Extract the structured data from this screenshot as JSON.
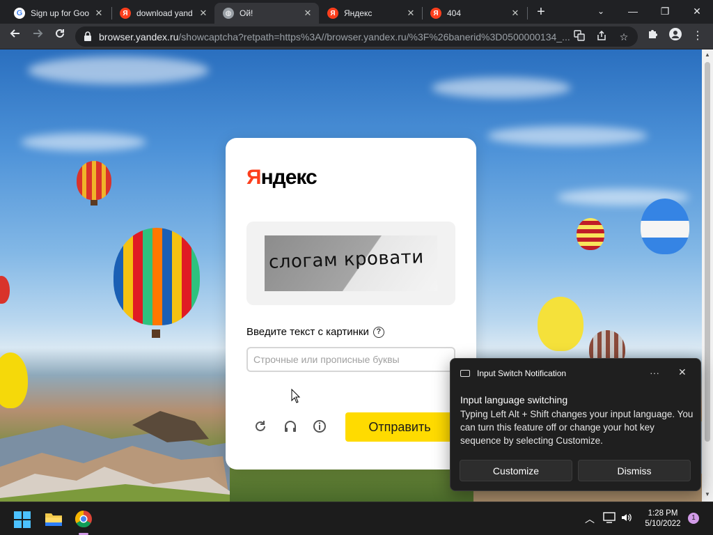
{
  "browser": {
    "tabs": [
      {
        "title": "Sign up for Goo",
        "favicon": "google-icon"
      },
      {
        "title": "download yand",
        "favicon": "yandex-icon"
      },
      {
        "title": "Ой!",
        "favicon": "globe-icon",
        "active": true
      },
      {
        "title": "Яндекс",
        "favicon": "yandex-icon"
      },
      {
        "title": "404",
        "favicon": "yandex-icon"
      }
    ],
    "url_host": "browser.yandex.ru",
    "url_path": "/showcaptcha?retpath=https%3A//browser.yandex.ru/%3F%26banerid%3D0500000134_..."
  },
  "captcha": {
    "logo": "Яндекс",
    "logo_first": "Я",
    "logo_rest": "ндекс",
    "image_text": "слогам кровати",
    "prompt": "Введите текст с картинки",
    "help_glyph": "?",
    "input_placeholder": "Строчные или прописные буквы",
    "input_value": "",
    "submit_label": "Отправить",
    "accent_color": "#ffdb00",
    "logo_color": "#fc3f1d"
  },
  "notification": {
    "app": "Input Switch Notification",
    "title": "Input language switching",
    "body": "Typing Left Alt + Shift changes your input language. You can turn this feature off or change your hot key sequence by selecting Customize.",
    "customize_label": "Customize",
    "dismiss_label": "Dismiss",
    "more_glyph": "···"
  },
  "taskbar": {
    "time": "1:28 PM",
    "date": "5/10/2022",
    "notification_count": "1"
  }
}
